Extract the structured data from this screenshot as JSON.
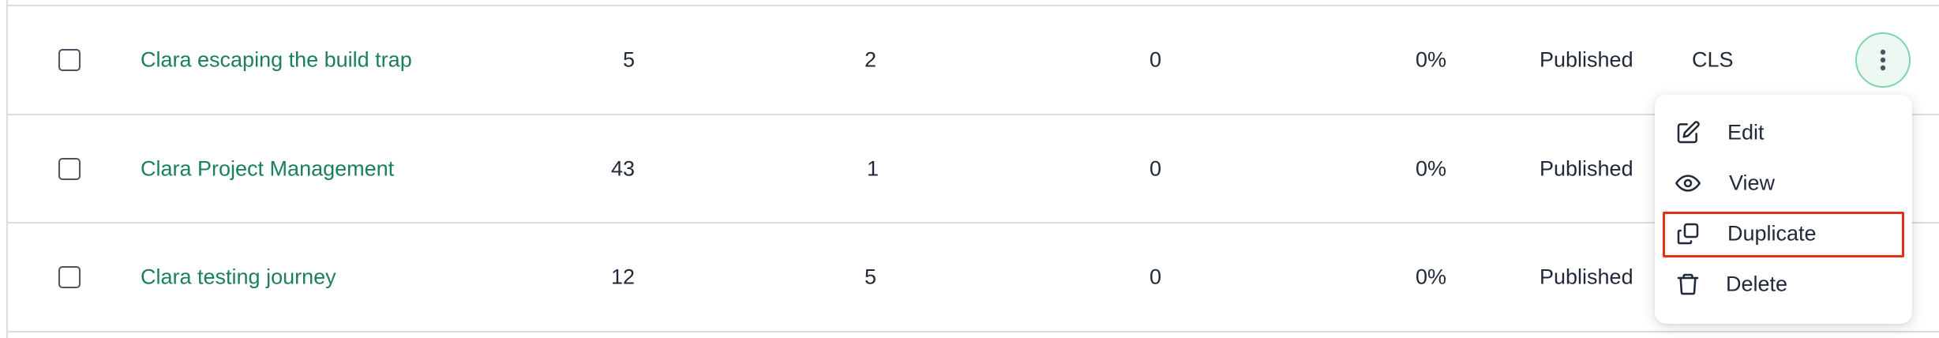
{
  "rows": [
    {
      "name": "Clara escaping the build trap",
      "col1": "5",
      "col2": "2",
      "col3": "0",
      "percent": "0%",
      "status": "Published",
      "code": "CLS"
    },
    {
      "name": "Clara Project Management",
      "col1": "43",
      "col2": "1",
      "col3": "0",
      "percent": "0%",
      "status": "Published",
      "code": ""
    },
    {
      "name": "Clara testing journey",
      "col1": "12",
      "col2": "5",
      "col3": "0",
      "percent": "0%",
      "status": "Published",
      "code": ""
    }
  ],
  "menu": {
    "items": [
      {
        "label": "Edit",
        "icon": "edit-icon"
      },
      {
        "label": "View",
        "icon": "eye-icon"
      },
      {
        "label": "Duplicate",
        "icon": "copy-icon"
      },
      {
        "label": "Delete",
        "icon": "trash-icon"
      }
    ]
  },
  "colors": {
    "link": "#1a7f5a",
    "kebab_border": "#7fd4ad",
    "highlight": "#e0321a"
  }
}
